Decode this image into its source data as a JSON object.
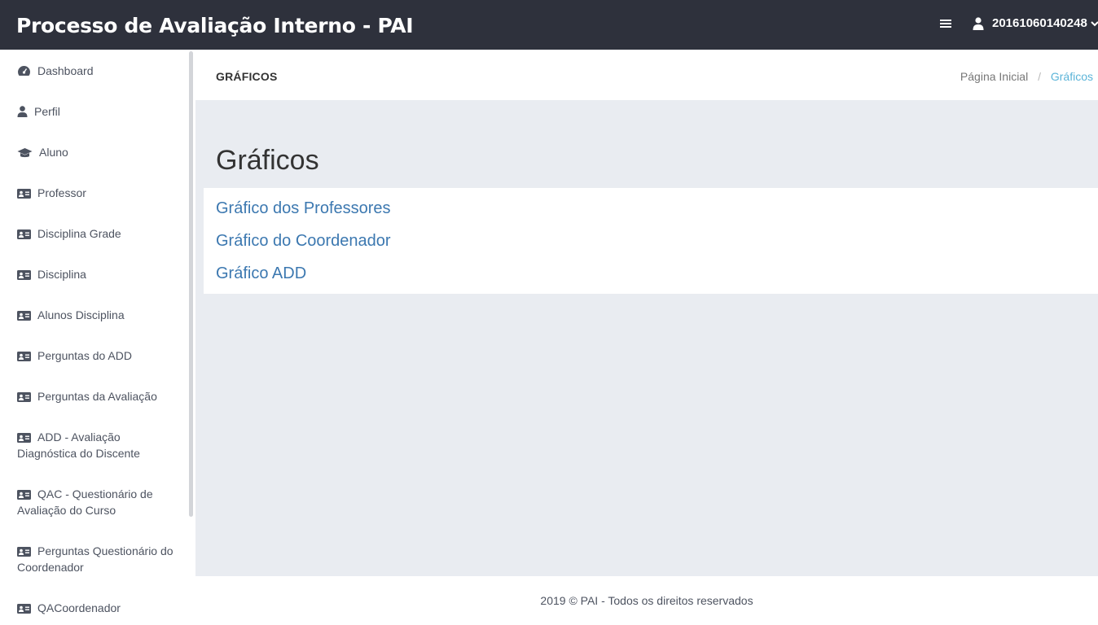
{
  "app": {
    "title": "Processo de Avaliação Interno - PAI",
    "user": "20161060140248"
  },
  "sidebar": {
    "items": [
      {
        "label": "Dashboard",
        "icon": "dashboard-icon"
      },
      {
        "label": "Perfil",
        "icon": "user-icon"
      },
      {
        "label": "Aluno",
        "icon": "graduation-cap-icon"
      },
      {
        "label": "Professor",
        "icon": "id-card-icon"
      },
      {
        "label": "Disciplina Grade",
        "icon": "id-card-icon"
      },
      {
        "label": "Disciplina",
        "icon": "id-card-icon"
      },
      {
        "label": "Alunos Disciplina",
        "icon": "id-card-icon"
      },
      {
        "label": "Perguntas do ADD",
        "icon": "id-card-icon"
      },
      {
        "label": "Perguntas da Avaliação",
        "icon": "id-card-icon"
      },
      {
        "label": "ADD - Avaliação Diagnóstica do Discente",
        "icon": "id-card-icon"
      },
      {
        "label": "QAC - Questionário de Avaliação do Curso",
        "icon": "id-card-icon"
      },
      {
        "label": "Perguntas Questionário do Coordenador",
        "icon": "id-card-icon"
      },
      {
        "label": "QACoordenador",
        "icon": "id-card-icon"
      }
    ]
  },
  "page_header": {
    "title": "GRÁFICOS",
    "breadcrumb": {
      "home": "Página Inicial",
      "separator": "/",
      "current": "Gráficos"
    }
  },
  "main": {
    "heading": "Gráficos",
    "links": [
      "Gráfico dos Professores",
      "Gráfico do Coordenador",
      "Gráfico ADD"
    ]
  },
  "footer": {
    "text": "2019 © PAI - Todos os direitos reservados"
  },
  "colors": {
    "topbar": "#2e313c",
    "content_bg": "#e9ecf1",
    "link": "#3c78b0",
    "breadcrumb_active": "#5bb4d8",
    "sidebar_text": "#4d5360"
  }
}
